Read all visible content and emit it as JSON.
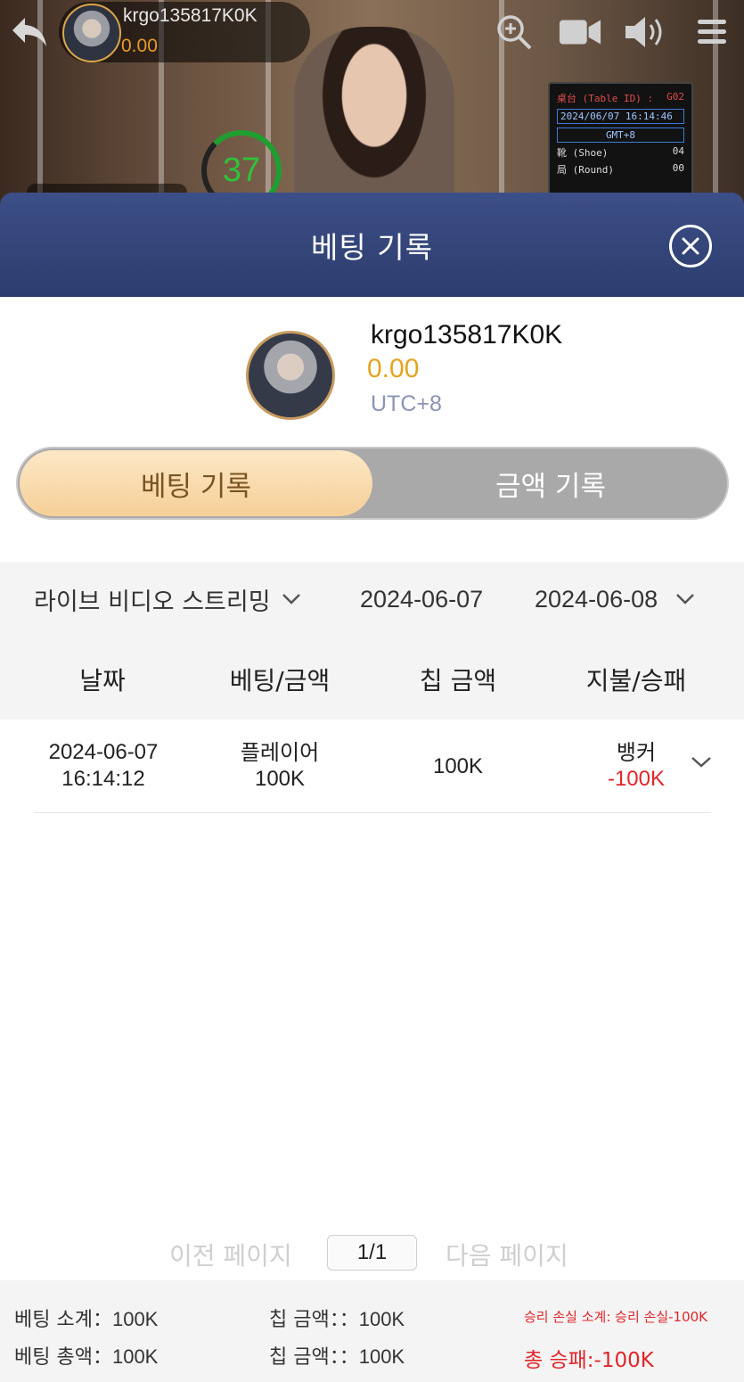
{
  "top_bar": {
    "username": "krgo135817K0K",
    "balance": "0.00",
    "timer": "37",
    "table_board": {
      "table_label": "桌台 (Table ID) :",
      "table_id": "G02",
      "datetime": "2024/06/07  16:14:46",
      "timezone": "GMT+8",
      "shoe_label": "靴 (Shoe)",
      "shoe_value": "04",
      "round_label": "局 (Round)",
      "round_value": "00"
    },
    "icons": [
      "back-arrow-icon",
      "zoom-in-icon",
      "video-camera-icon",
      "speaker-icon",
      "menu-icon"
    ]
  },
  "modal": {
    "title": "베팅 기록",
    "close_icon": "close-circle-icon"
  },
  "profile": {
    "username": "krgo135817K0K",
    "balance": "0.00",
    "timezone": "UTC+8"
  },
  "tabs": {
    "active": "베팅 기록",
    "inactive": "금액 기록"
  },
  "filters": {
    "game_type": "라이브 비디오 스트리밍",
    "start_date": "2024-06-07",
    "end_date": "2024-06-08"
  },
  "table": {
    "headers": [
      "날짜",
      "베팅/금액",
      "칩 금액",
      "지불/승패"
    ],
    "rows": [
      {
        "date": "2024-06-07",
        "time": "16:14:12",
        "bet_type": "플레이어",
        "bet_amount": "100K",
        "chip_amount": "100K",
        "payout_type": "뱅커",
        "win_loss": "-100K"
      }
    ]
  },
  "pagination": {
    "prev": "이전 페이지",
    "current": "1/1",
    "next": "다음 페이지"
  },
  "summary": {
    "bet_subtotal_label": "베팅 소계：",
    "bet_subtotal_value": "100K",
    "chip_amount_label_1": "칩 금액：：",
    "chip_amount_value_1": "100K",
    "winloss_subtotal": "승리 손실 소계: 승리 손실-100K",
    "bet_total_label": "베팅 총액：",
    "bet_total_value": "100K",
    "chip_amount_label_2": "칩 금액：：",
    "chip_amount_value_2": "100K",
    "total_winloss": "총 승패:-100K"
  },
  "colors": {
    "header_bg": "#33467a",
    "tab_active_bg": "#f8d9a8",
    "tab_inactive_bg": "#a9a9a9",
    "balance_gold": "#e3a51e",
    "negative_red": "#e0262b"
  }
}
